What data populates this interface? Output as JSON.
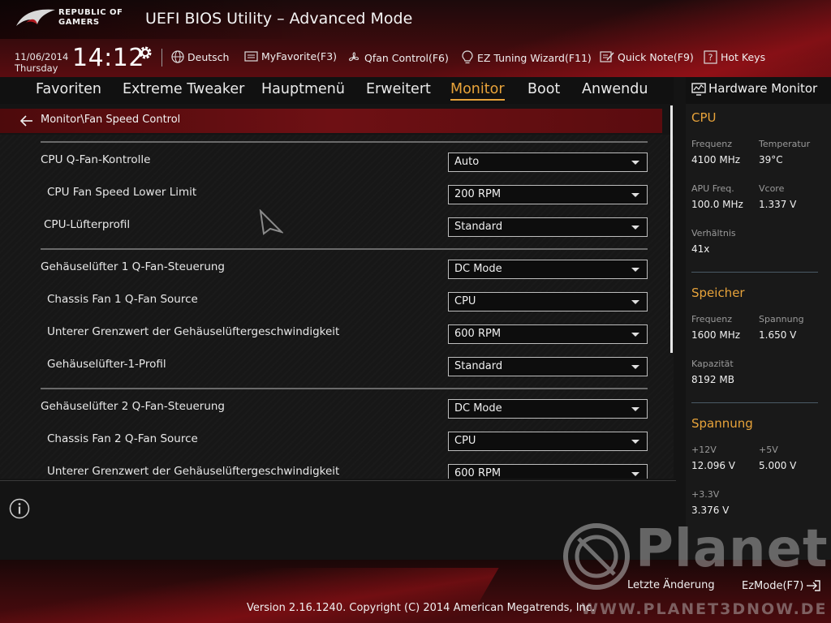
{
  "header": {
    "brand_line1": "REPUBLIC OF",
    "brand_line2": "GAMERS",
    "title": "UEFI BIOS Utility – Advanced Mode",
    "date": "11/06/2014",
    "day": "Thursday",
    "time": "14:12",
    "language": "Deutsch",
    "tools": {
      "myfavorite": "MyFavorite(F3)",
      "qfan": "Qfan Control(F6)",
      "ez_tuning": "EZ Tuning Wizard(F11)",
      "quick_note": "Quick Note(F9)",
      "hot_keys": "Hot Keys"
    }
  },
  "nav": {
    "tabs": [
      "Favoriten",
      "Extreme Tweaker",
      "Hauptmenü",
      "Erweitert",
      "Monitor",
      "Boot",
      "Anwendu"
    ],
    "active": "Monitor"
  },
  "breadcrumb": "Monitor\\Fan Speed Control",
  "settings": [
    {
      "label": "CPU Q-Fan-Kontrolle",
      "value": "Auto"
    },
    {
      "label": "CPU Fan Speed Lower Limit",
      "value": "200 RPM"
    },
    {
      "label": "CPU-Lüfterprofil",
      "value": "Standard"
    },
    {
      "label": "Gehäuselüfter 1 Q-Fan-Steuerung",
      "value": "DC Mode"
    },
    {
      "label": "Chassis Fan 1 Q-Fan Source",
      "value": "CPU"
    },
    {
      "label": "Unterer Grenzwert der Gehäuselüftergeschwindigkeit",
      "value": "600 RPM"
    },
    {
      "label": "Gehäuselüfter-1-Profil",
      "value": "Standard"
    },
    {
      "label": "Gehäuselüfter 2 Q-Fan-Steuerung",
      "value": "DC Mode"
    },
    {
      "label": "Chassis Fan 2 Q-Fan Source",
      "value": "CPU"
    },
    {
      "label": "Unterer Grenzwert der Gehäuselüftergeschwindigkeit",
      "value": "600 RPM"
    }
  ],
  "hardware_monitor": {
    "title": "Hardware Monitor",
    "cpu": {
      "heading": "CPU",
      "freq_label": "Frequenz",
      "freq_value": "4100 MHz",
      "temp_label": "Temperatur",
      "temp_value": "39°C",
      "apu_label": "APU Freq.",
      "apu_value": "100.0 MHz",
      "vcore_label": "Vcore",
      "vcore_value": "1.337 V",
      "ratio_label": "Verhältnis",
      "ratio_value": "41x"
    },
    "memory": {
      "heading": "Speicher",
      "freq_label": "Frequenz",
      "freq_value": "1600 MHz",
      "volt_label": "Spannung",
      "volt_value": "1.650 V",
      "cap_label": "Kapazität",
      "cap_value": "8192 MB"
    },
    "voltage": {
      "heading": "Spannung",
      "v12_label": "+12V",
      "v12_value": "12.096 V",
      "v5_label": "+5V",
      "v5_value": "5.000 V",
      "v33_label": "+3.3V",
      "v33_value": "3.376 V"
    }
  },
  "footer": {
    "last_change": "Letzte Änderung",
    "ezmode": "EzMode(F7)",
    "version": "Version 2.16.1240. Copyright (C) 2014 American Megatrends, Inc."
  },
  "watermark": {
    "name": "Planet",
    "url": "WWW.PLANET3DNOW.DE"
  },
  "colors": {
    "accent": "#e8a33a",
    "brand_red": "#6e1014"
  }
}
